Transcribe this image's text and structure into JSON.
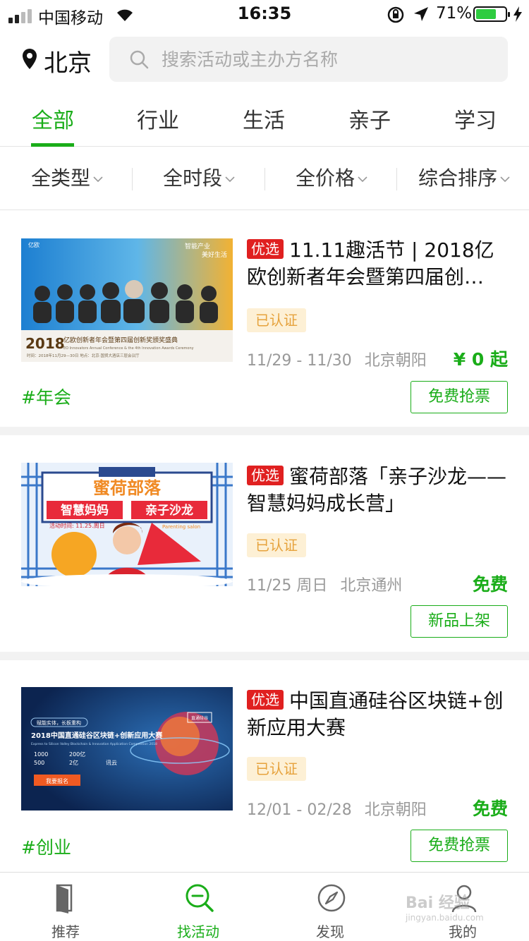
{
  "status_bar": {
    "carrier": "中国移动",
    "time": "16:35",
    "battery_percent": "71%",
    "battery_level": 0.71
  },
  "header": {
    "city": "北京",
    "search_placeholder": "搜索活动或主办方名称"
  },
  "tabs": [
    "全部",
    "行业",
    "生活",
    "亲子",
    "学习"
  ],
  "active_tab": "全部",
  "filters": [
    "全类型",
    "全时段",
    "全价格",
    "综合排序"
  ],
  "events": [
    {
      "badge": "优选",
      "title": "11.11趣活节 | 2018亿欧创新者年会暨第四届创…",
      "verified": "已认证",
      "date": "11/29 - 11/30",
      "location": "北京朝阳",
      "price": "¥ 0 起",
      "hashtag": "#年会",
      "action": "免费抢票",
      "thumb": {
        "logo": "亿欧",
        "slogan1": "智能产业",
        "slogan2": "美好生活",
        "year": "2018",
        "headline": "亿欧创新者年会暨第四届创新奖颁奖盛典",
        "sub": "EO Innovators Annual Conference & the 4th Innovation Awards Ceremony",
        "info": "时间：2018年11月29—30日   地点：北京·国贸大酒店三层会议厅"
      }
    },
    {
      "badge": "优选",
      "title": "蜜荷部落「亲子沙龙——智慧妈妈成长营」",
      "verified": "已认证",
      "date": "11/25 周日",
      "location": "北京通州",
      "price": "免费",
      "hashtag": "",
      "action": "新品上架",
      "thumb": {
        "brand": "蜜荷部落",
        "left": "智慧妈妈",
        "right": "亲子沙龙",
        "time": "活动时间: 11.25.周日",
        "en": "Parenting salon"
      }
    },
    {
      "badge": "优选",
      "title": "中国直通硅谷区块链+创新应用大赛",
      "verified": "已认证",
      "date": "12/01 - 02/28",
      "location": "北京朝阳",
      "price": "免费",
      "hashtag": "#创业",
      "action": "免费抢票",
      "thumb": {
        "tag": "赋能实体，长板重构",
        "headline": "2018中国直通硅谷区块链+创新应用大赛",
        "sub": "Express to Silicon Valley Blockchain & Innovation Application Competition 2018",
        "stats": [
          "1000",
          "200亿",
          "500",
          "2亿",
          "讯云"
        ],
        "cta": "我要报名",
        "badge": "直通硅谷"
      }
    }
  ],
  "tabbar": [
    "推荐",
    "找活动",
    "发现",
    "我的"
  ],
  "tabbar_active": "找活动",
  "watermark": {
    "text": "Bai 经验",
    "sub": "jingyan.baidu.com"
  },
  "colors": {
    "accent": "#1aad19",
    "badge": "#e02020",
    "verified_bg": "#fdf0d5",
    "verified_text": "#e6a23c"
  }
}
